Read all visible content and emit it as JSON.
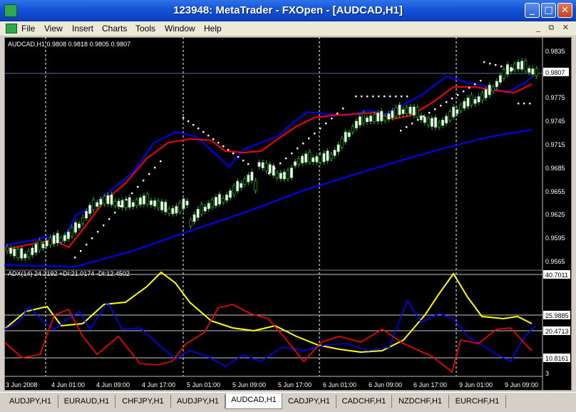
{
  "window": {
    "title": "123948: MetaTrader - FXOpen - [AUDCAD,H1]",
    "controls": {
      "minimize": "_",
      "maximize": "□",
      "close": "✕"
    }
  },
  "menu": {
    "items": [
      "File",
      "View",
      "Insert",
      "Charts",
      "Tools",
      "Window",
      "Help"
    ],
    "mdi_controls": "_ ⧉ ✕"
  },
  "chart": {
    "price_header": "AUDCAD,H1  0.9808 0.9818 0.9805 0.9807",
    "current_price": "0.9807",
    "price_ticks": [
      "0.9835",
      "0.9807",
      "0.9775",
      "0.9745",
      "0.9715",
      "0.9685",
      "0.9655",
      "0.9625",
      "0.9595",
      "0.9565"
    ],
    "adx_header": "ADX(14) 24.2192  +DI:21.0174  -DI:12.4502",
    "adx_ticks": [
      "40.7011",
      "25.9885",
      "20.4713",
      "10.8161",
      "3"
    ],
    "time_ticks": [
      "3 Jun 2008",
      "4 Jun 01:00",
      "4 Jun 09:00",
      "4 Jun 17:00",
      "5 Jun 01:00",
      "5 Jun 09:00",
      "5 Jun 17:00",
      "6 Jun 01:00",
      "6 Jun 09:00",
      "6 Jun 17:00",
      "9 Jun 01:00",
      "9 Jun 09:00"
    ],
    "colors": {
      "background": "#000000",
      "bull_candle": "#ffffff",
      "bear_candle": "#000000",
      "candle_wick": "#2fb82f",
      "ma_fast": "#0000ff",
      "ma_slow": "#ff0000",
      "ma_long": "#0000ff",
      "sar": "#ffffff",
      "adx": "#ffff00",
      "plus_di": "#0000ff",
      "minus_di": "#ff0000"
    }
  },
  "tabs": [
    {
      "label": "AUDJPY,H1",
      "active": false
    },
    {
      "label": "EURAUD,H1",
      "active": false
    },
    {
      "label": "CHFJPY,H1",
      "active": false
    },
    {
      "label": "AUDJPY,H1",
      "active": false
    },
    {
      "label": "AUDCAD,H1",
      "active": true
    },
    {
      "label": "CADJPY,H1",
      "active": false
    },
    {
      "label": "CADCHF,H1",
      "active": false
    },
    {
      "label": "NZDCHF,H1",
      "active": false
    },
    {
      "label": "EURCHF,H1",
      "active": false
    }
  ]
}
